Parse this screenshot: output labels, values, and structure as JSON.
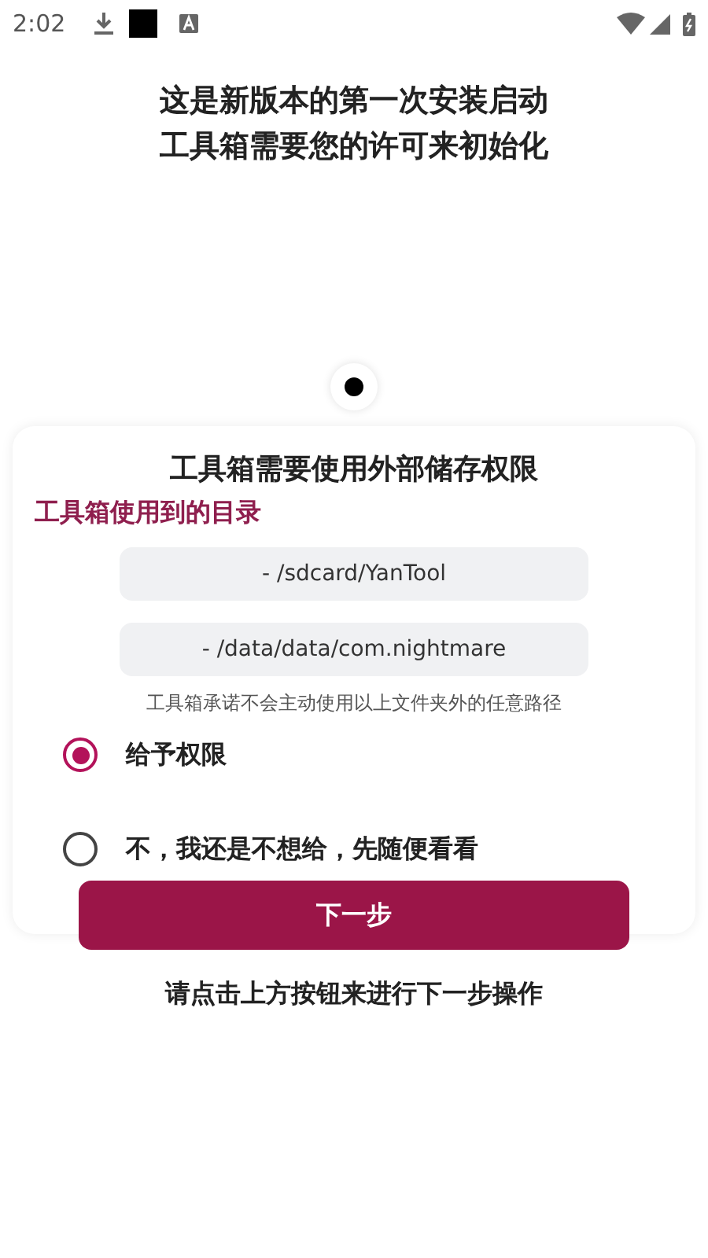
{
  "status_bar": {
    "time": "2:02"
  },
  "intro_lines": [
    "这是新版本的第一次安装启动",
    "工具箱需要您的许可来初始化"
  ],
  "pager": [
    {
      "selected": true
    }
  ],
  "card": {
    "title": "工具箱需要使用外部储存权限",
    "section_title": "工具箱使用到的目录",
    "paths": [
      "- /sdcard/YanTool",
      "- /data/data/com.nightmare"
    ],
    "note": "工具箱承诺不会主动使用以上文件夹外的任意路径",
    "options": [
      {
        "label": "给予权限",
        "selected": true
      },
      {
        "label": "不，我还是不想给，先随便看看",
        "selected": false
      }
    ]
  },
  "next_button": "下一步",
  "hint": "请点击上方按钮来进行下一步操作"
}
